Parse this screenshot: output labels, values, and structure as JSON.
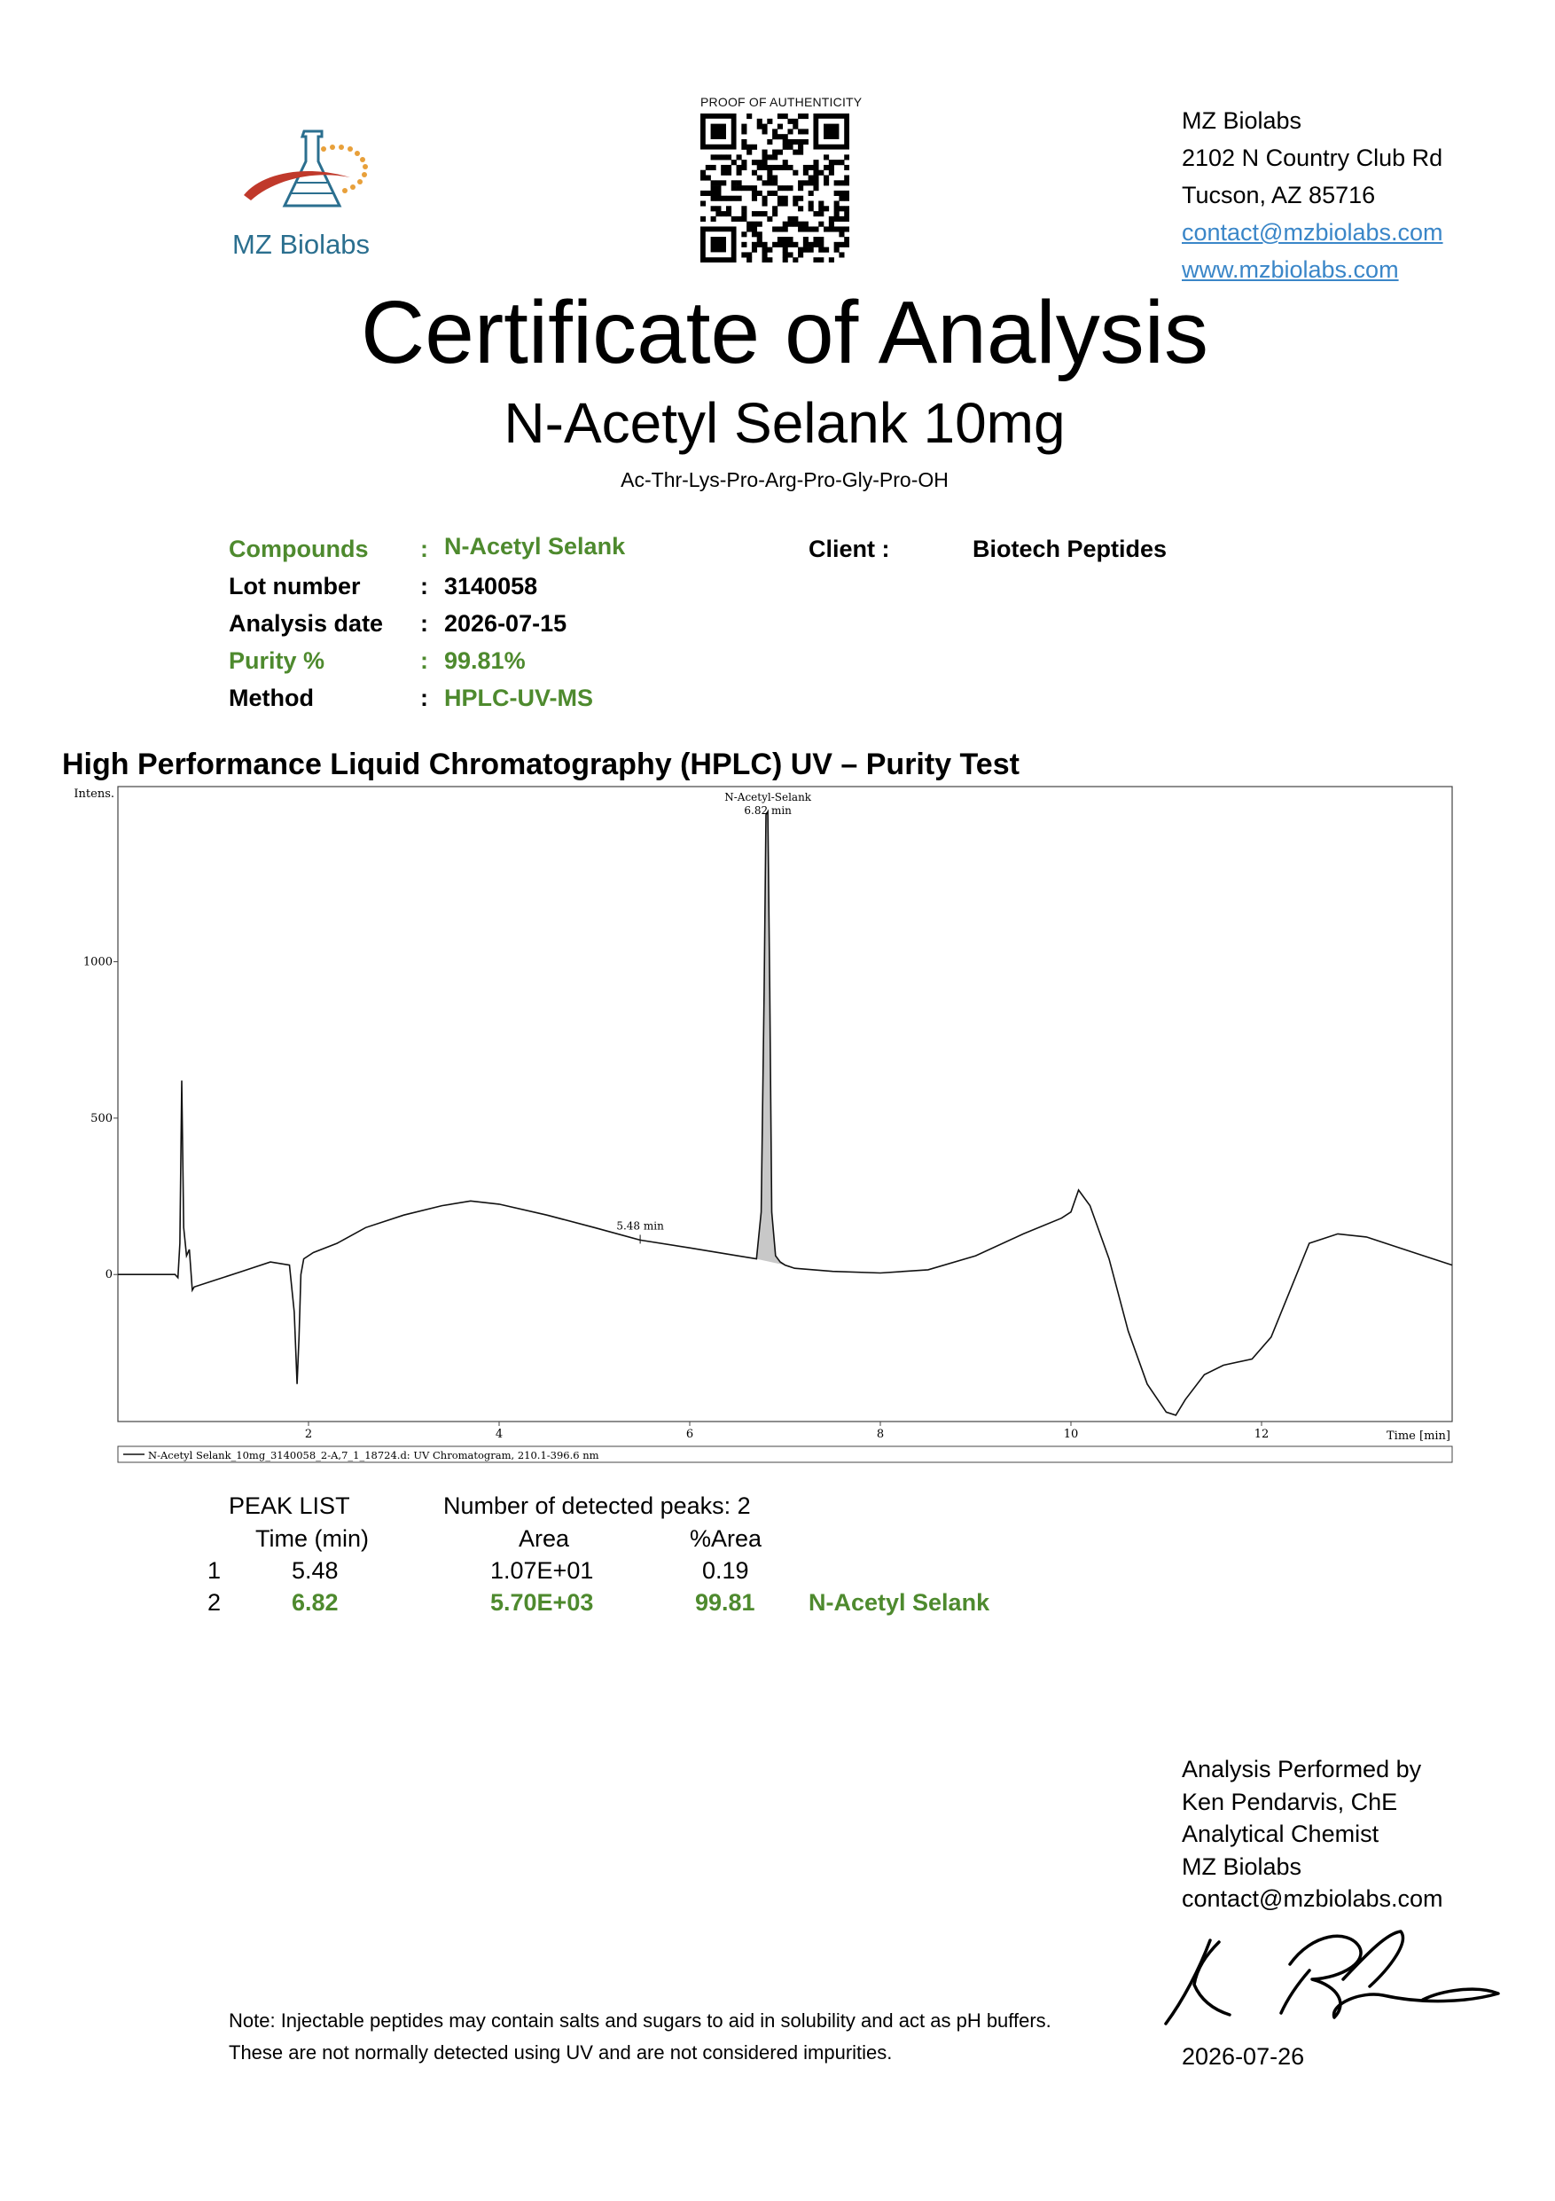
{
  "header": {
    "logo_text": "MZ Biolabs",
    "qr_caption": "PROOF OF AUTHENTICITY",
    "lab_name": "MZ Biolabs",
    "address_line1": "2102 N Country Club Rd",
    "address_line2": "Tucson, AZ 85716",
    "email": "contact@mzbiolabs.com",
    "website": "www.mzbiolabs.com"
  },
  "title": "Certificate of Analysis",
  "subtitle": "N-Acetyl Selank  10mg",
  "sequence": "Ac-Thr-Lys-Pro-Arg-Pro-Gly-Pro-OH",
  "info": {
    "compounds_label": "Compounds",
    "compounds_value": "N-Acetyl Selank",
    "lot_label": "Lot number",
    "lot_value": "3140058",
    "date_label": "Analysis date",
    "date_value": "2026-07-15",
    "purity_label": "Purity %",
    "purity_value": "99.81%",
    "method_label": "Method",
    "method_value": "HPLC-UV-MS",
    "client_label": "Client :",
    "client_value": "Biotech Peptides",
    "separator": ":"
  },
  "section_title": "High Performance Liquid Chromatography (HPLC) UV – Purity Test",
  "chart_data": {
    "type": "line",
    "ylabel": "Intens.",
    "xlabel": "Time [min]",
    "xlim": [
      0,
      14
    ],
    "ylim": [
      -470,
      1560
    ],
    "x_ticks": [
      2,
      4,
      6,
      8,
      10,
      12
    ],
    "y_ticks": [
      0,
      500,
      1000
    ],
    "series": [
      {
        "name": "N-Acetyl Selank_10mg_3140058_2-A,7_1_18724.d: UV Chromatogram, 210.1-396.6 nm",
        "x": [
          0.0,
          0.4,
          0.6,
          0.63,
          0.65,
          0.67,
          0.69,
          0.72,
          0.75,
          0.78,
          0.8,
          1.0,
          1.3,
          1.6,
          1.8,
          1.85,
          1.88,
          1.9,
          1.92,
          1.95,
          2.05,
          2.3,
          2.6,
          3.0,
          3.4,
          3.7,
          4.0,
          4.5,
          5.0,
          5.48,
          6.0,
          6.5,
          6.7,
          6.75,
          6.78,
          6.8,
          6.82,
          6.84,
          6.86,
          6.9,
          6.95,
          7.0,
          7.1,
          7.5,
          8.0,
          8.5,
          9.0,
          9.5,
          9.9,
          10.0,
          10.08,
          10.2,
          10.4,
          10.6,
          10.8,
          11.0,
          11.1,
          11.2,
          11.4,
          11.6,
          11.9,
          12.1,
          12.3,
          12.5,
          12.8,
          13.1,
          13.4,
          13.7,
          14.0
        ],
        "values": [
          0,
          0,
          0,
          -10,
          100,
          620,
          150,
          60,
          80,
          -50,
          -40,
          -20,
          10,
          40,
          30,
          -120,
          -350,
          -200,
          0,
          50,
          70,
          100,
          150,
          190,
          220,
          235,
          225,
          190,
          150,
          110,
          85,
          60,
          50,
          200,
          900,
          1470,
          1480,
          900,
          200,
          60,
          40,
          30,
          20,
          10,
          5,
          15,
          60,
          130,
          180,
          200,
          270,
          220,
          50,
          -180,
          -350,
          -440,
          -450,
          -400,
          -320,
          -290,
          -270,
          -200,
          -50,
          100,
          130,
          120,
          90,
          60,
          30
        ]
      }
    ],
    "annotations": [
      {
        "text_line1": "N-Acetyl-Selank",
        "text_line2": "6.82 min",
        "x": 6.82
      },
      {
        "text_line1": "5.48 min",
        "x": 5.48
      }
    ]
  },
  "peak_list": {
    "title": "PEAK LIST",
    "detected": "Number of detected peaks: 2",
    "col_time": "Time (min)",
    "col_area": "Area",
    "col_parea": "%Area",
    "rows": [
      {
        "num": "1",
        "time": "5.48",
        "area": "1.07E+01",
        "parea": "0.19",
        "name": ""
      },
      {
        "num": "2",
        "time": "6.82",
        "area": "5.70E+03",
        "parea": "99.81",
        "name": "N-Acetyl Selank"
      }
    ]
  },
  "note": {
    "line1": "Note: Injectable peptides may contain salts and sugars to aid in solubility and act as pH buffers.",
    "line2": "These are not normally detected using UV and are not considered impurities."
  },
  "signature": {
    "line1": "Analysis Performed by",
    "line2": "Ken Pendarvis, ChE",
    "line3": "Analytical Chemist",
    "line4": "MZ Biolabs",
    "line5": "contact@mzbiolabs.com",
    "date": "2026-07-26"
  },
  "colors": {
    "accent_green": "#4e8a2e",
    "link_blue": "#3a86c8",
    "logo_blue": "#2b6f8f",
    "logo_red": "#c0392b",
    "logo_orange": "#e8a03a"
  }
}
